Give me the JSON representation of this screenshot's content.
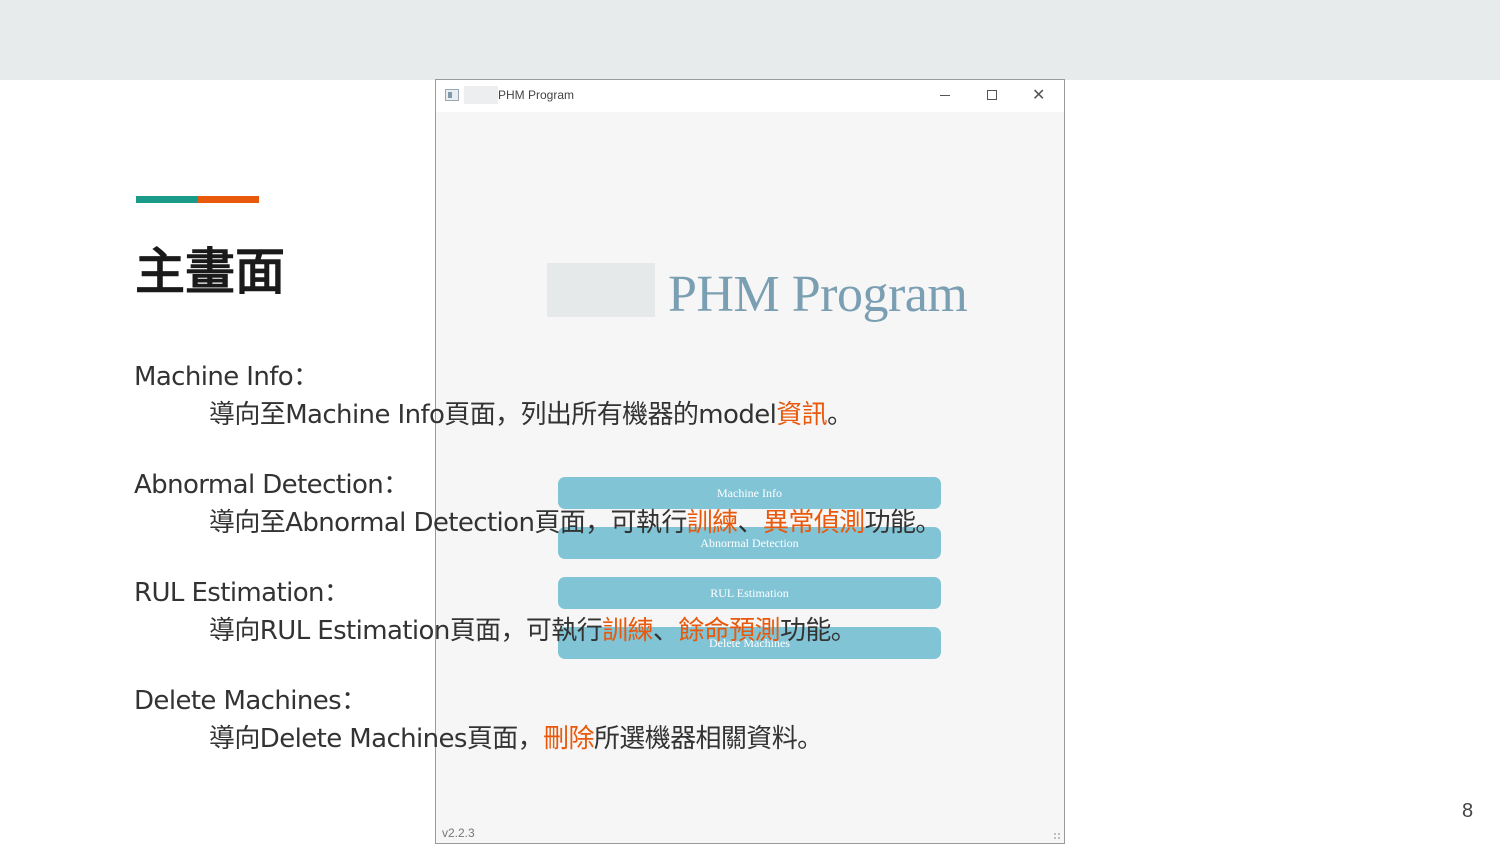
{
  "slide": {
    "title": "主畫面",
    "page_number": "8",
    "accent_colors": [
      "#1a9a88",
      "#e8590c"
    ],
    "highlight_color": "#e8590c",
    "items": [
      {
        "heading": "Machine Info：",
        "desc_pre": "導向至Machine Info頁面，列出所有機器的model",
        "desc_hl1": "資訊",
        "desc_mid": "",
        "desc_hl2": "",
        "desc_post": "。"
      },
      {
        "heading": "Abnormal Detection：",
        "desc_pre": "導向至Abnormal Detection頁面，可執行",
        "desc_hl1": "訓練",
        "desc_mid": "、",
        "desc_hl2": "異常偵測",
        "desc_post": "功能。"
      },
      {
        "heading": "RUL Estimation：",
        "desc_pre": "導向RUL Estimation頁面，可執行",
        "desc_hl1": "訓練",
        "desc_mid": "、",
        "desc_hl2": "餘命預測",
        "desc_post": "功能。"
      },
      {
        "heading": "Delete Machines：",
        "desc_pre": "導向Delete Machines頁面，",
        "desc_hl1": "刪除",
        "desc_mid": "",
        "desc_hl2": "",
        "desc_post": "所選機器相關資料。"
      }
    ]
  },
  "window": {
    "title": "PHM Program",
    "app_title": "PHM Program",
    "version": "v2.2.3",
    "buttons": {
      "machine_info": "Machine Info",
      "abnormal_detection": "Abnormal Detection",
      "rul_estimation": "RUL Estimation",
      "delete_machines": "Delete Machines"
    },
    "button_color": "#80c4d6",
    "title_color": "#7a9fb2",
    "icons": [
      "app-icon",
      "minimize-icon",
      "maximize-icon",
      "close-icon"
    ]
  }
}
